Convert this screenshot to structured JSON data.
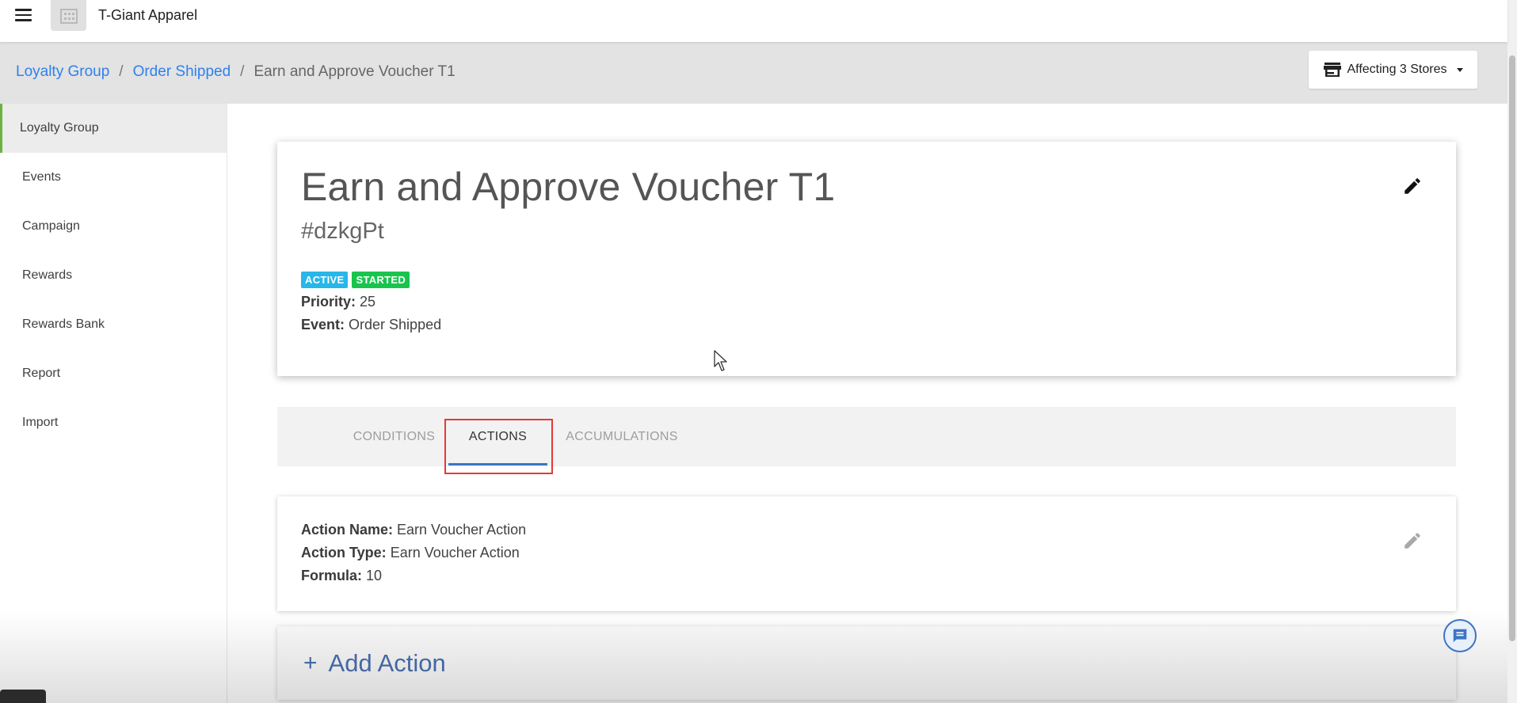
{
  "app": {
    "title": "T-Giant Apparel"
  },
  "breadcrumb": {
    "items": [
      "Loyalty Group",
      "Order Shipped"
    ],
    "current": "Earn and Approve Voucher T1",
    "separator": "/"
  },
  "store_selector": {
    "label": "Affecting 3 Stores"
  },
  "sidebar": {
    "items": [
      {
        "label": "Loyalty Group"
      },
      {
        "label": "Events"
      },
      {
        "label": "Campaign"
      },
      {
        "label": "Rewards"
      },
      {
        "label": "Rewards Bank"
      },
      {
        "label": "Report"
      },
      {
        "label": "Import"
      }
    ],
    "active": "Loyalty Group"
  },
  "rule": {
    "title": "Earn and Approve Voucher T1",
    "code": "#dzkgPt",
    "badges": {
      "active": "ACTIVE",
      "started": "STARTED"
    },
    "priority_label": "Priority:",
    "priority_value": "25",
    "event_label": "Event:",
    "event_value": "Order Shipped"
  },
  "tabs": {
    "items": [
      {
        "label": "CONDITIONS"
      },
      {
        "label": "ACTIONS"
      },
      {
        "label": "ACCUMULATIONS"
      }
    ],
    "active": "ACTIONS"
  },
  "action": {
    "name_label": "Action Name:",
    "name_value": "Earn Voucher Action",
    "type_label": "Action Type:",
    "type_value": "Earn Voucher Action",
    "formula_label": "Formula:",
    "formula_value": "10"
  },
  "add_action": {
    "plus": "+",
    "label": "Add Action"
  },
  "colors": {
    "link": "#2f80ed",
    "badge_active": "#29b6e8",
    "badge_started": "#19c44e",
    "tab_underline": "#3d74c5",
    "highlight": "#e53935",
    "sidebar_active_border": "#6cb23f"
  }
}
